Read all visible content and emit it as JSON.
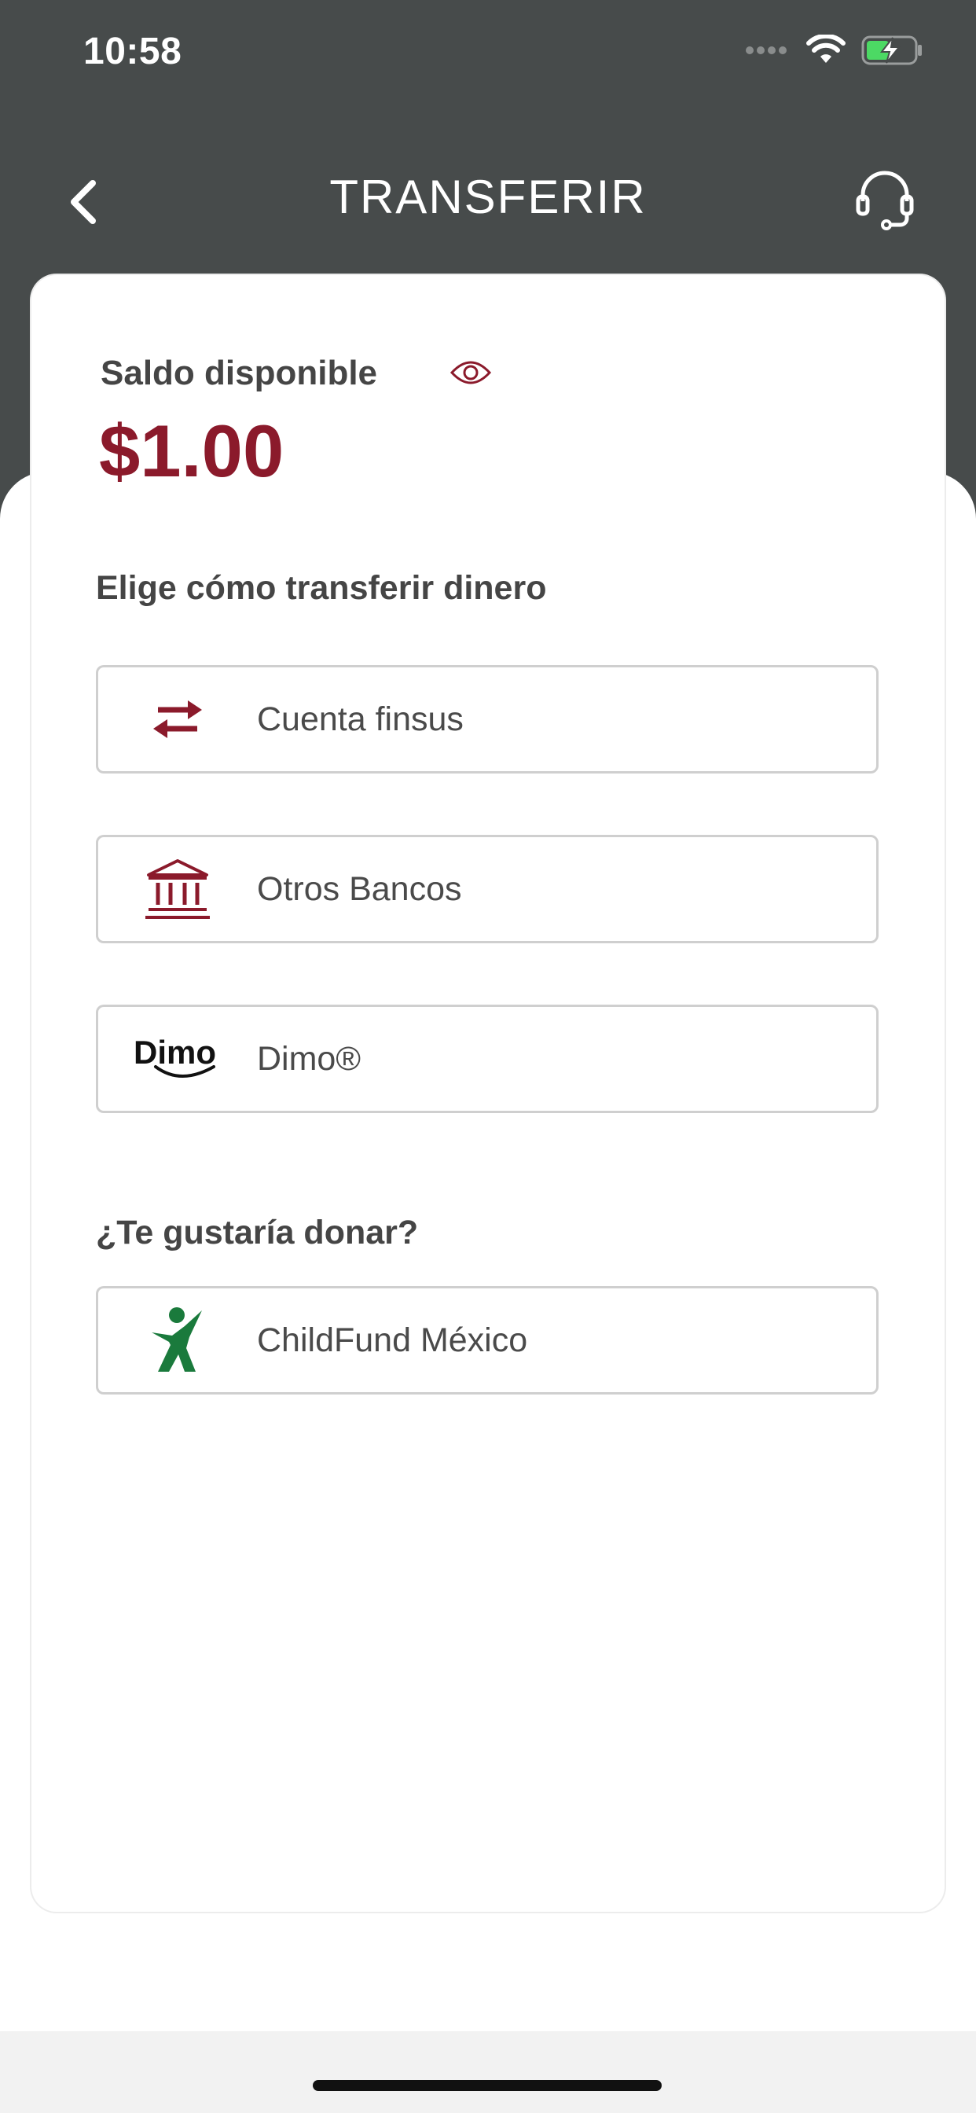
{
  "status_bar": {
    "time": "10:58"
  },
  "nav": {
    "title": "TRANSFERIR"
  },
  "balance": {
    "label": "Saldo disponible",
    "amount": "$1.00"
  },
  "transfer_section": {
    "title": "Elige cómo transferir dinero",
    "options": [
      {
        "label": "Cuenta finsus",
        "icon": "swap-arrows-icon"
      },
      {
        "label": "Otros Bancos",
        "icon": "bank-icon"
      },
      {
        "label": "Dimo®",
        "icon": "dimo-logo",
        "logo_text": "Dimo"
      }
    ]
  },
  "donate_section": {
    "title": "¿Te gustaría donar?",
    "options": [
      {
        "label": "ChildFund México",
        "icon": "childfund-logo"
      }
    ]
  },
  "colors": {
    "header": "#474b4b",
    "accent": "#8b1a2b",
    "childfund_green": "#1a7a3c"
  }
}
